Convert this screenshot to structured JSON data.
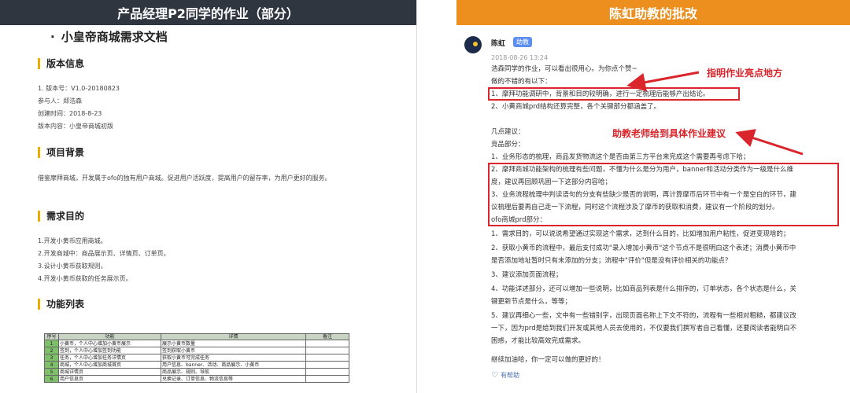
{
  "left": {
    "header": "产品经理P2同学的作业（部分）",
    "doc_title": "小皇帝商城需求文档",
    "sections": {
      "version": "版本信息",
      "background": "项目背景",
      "purpose": "需求目的",
      "features": "功能列表"
    },
    "version_lines": [
      "1. 版本号：V1.0-20180823",
      "参与人：郑浩森",
      "创建时间：2018-8-23",
      "版本内容：小皇帝商城初版"
    ],
    "background_text": "借鉴摩拜商城，开发属于ofo的独有用户商城。促进用户活跃度，提高用户的留存率，为用户更好的服务。",
    "purpose_lines": [
      "1.开发小黄币应用商城。",
      "2.开发商城中：商品展示页、详情页、订单页。",
      "3.设计小黄币获取规则。",
      "4.开发小黄币获取的任务展示页。"
    ],
    "table": {
      "headers": [
        "序号",
        "功能",
        "详情",
        "备注"
      ],
      "rows": [
        [
          "1",
          "小黄币，个人中心增加小黄币展示",
          "展示小黄币数量",
          ""
        ],
        [
          "2",
          "签到，个人中心增加签到功能",
          "签到获取小黄币",
          ""
        ],
        [
          "3",
          "任务，个人中心增加任务详情页",
          "获取小黄币可完成任务",
          ""
        ],
        [
          "4",
          "商城，个人中心增加商城首页",
          "用户信息、banner、活动、商品展示、小黄币",
          ""
        ],
        [
          "5",
          "商城详情页",
          "商品展示、规则、导航",
          ""
        ],
        [
          "6",
          "用户信息页",
          "兑换记录、订单信息、物流信息等",
          ""
        ]
      ]
    }
  },
  "right": {
    "header": "陈虹助教的批改",
    "commenter": "陈虹",
    "badge": "助教",
    "timestamp": "2018-08-26 13:24",
    "lines": [
      "浩森同学的作业，可以看出很用心。为你点个赞~",
      "做的不错的有以下：",
      "1、摩拜功能调研中，背景和目的较明确，进行一定梳理后能够产出结论。",
      "2、小黄商城prd结构还算完整，各个关键部分都涵盖了。",
      "",
      "几点建议：",
      "竞品部分：",
      "1、业务形态的梳理，商品发货物流这个是否由第三方平台来完成这个需要再考虑下哈；",
      "2、摩拜商城功能架构的梳理有些问题，不懂为什么是分为用户，banner和活动分类作为一级是什么维",
      "度，建议再回顾巩固一下这部分内容哈；",
      "3、业务流程梳理中判读语句的分支有些缺少是否的说明，再计算摩币后环节中有一个是空白的环节，建",
      "议梳理后要再自己走一下流程，同时这个流程涉及了摩币的获取和消费，建议有一个阶段的划分。",
      "ofo商城prd部分：",
      "1、需求目的，可以说说希望通过实现这个需求，达到什么目的，比如增加用户粘性，促进变现啥的；",
      "2、获取小黄币的流程中，最后支付成功\"录入增加小黄币\"这个节点不是很明白这个表述；消费小黄币中",
      "是否添加地址暂时只有未添加的分支；流程中\"评价\"但是没有评价相关的功能点？",
      "3、建议添加页面流程；",
      "4、功能详述部分，还可以增加一些说明，比如商品列表是什么排序的，订单状态，各个状态是什么，关",
      "键更新节点是什么，等等；",
      "5、建议再细心一些，文中有一些错别字，出现页面名称上下文不符的，流程有一些相对粗糙，都建议改",
      "一下，因为prd是给到我们开发或其他人员去使用的，不仅要我们撰写者自己看懂，还要阅读者能明白不",
      "困惑，才能比较高效完成需求。",
      "",
      "继续加油哈，你一定可以做的更好的！"
    ],
    "annotations": {
      "highlight": "指明作业亮点地方",
      "advice": "助教老师给到具体作业建议"
    },
    "helpful": "有帮助",
    "colors": {
      "right_header": "#ed8f1e",
      "left_header": "#2f3640",
      "annotation_red": "#d9252b",
      "badge_blue": "#5b8ef0"
    }
  }
}
